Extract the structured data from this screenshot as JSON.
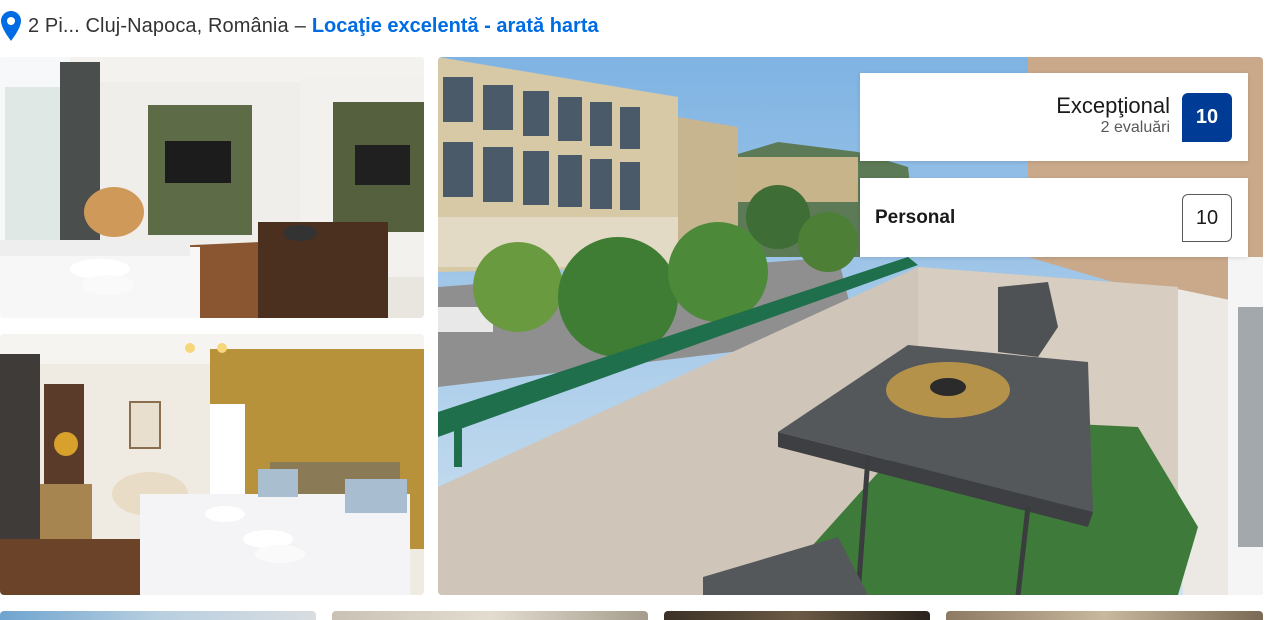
{
  "address": {
    "pin_icon": "map-pin-icon",
    "text": "2 Pi... Cluj-Napoca, România",
    "separator": "–",
    "map_link": "Locaţie excelentă - arată harta"
  },
  "rating": {
    "label": "Excepţional",
    "reviews": "2 evaluări",
    "score": "10"
  },
  "subscore": {
    "label": "Personal",
    "score": "10"
  },
  "colors": {
    "accent_link": "#006ce4",
    "score_badge": "#003b95",
    "balcony_railing": "#1f6f4d",
    "artificial_grass": "#3e7a3a"
  },
  "thumbnails": {
    "count": 4
  }
}
